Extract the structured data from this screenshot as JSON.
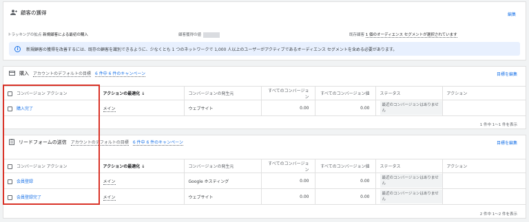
{
  "header": {
    "title": "顧客の獲得",
    "edit": "編集",
    "tracking_label": "トラッキングの拡点",
    "tracking_value": "新規顧客による最初の購入",
    "value_label": "顧客獲得の値",
    "existing_label": "既存顧客",
    "existing_value": "1 個のオーディエンス セグメントが選択されています",
    "info": "新規顧客の獲得を改善するには、既存の顧客を識別できるように、少なくとも 1 つのネットワークで 1,000 人以上のユーザーがアクティブであるオーディエンス セグメントを含める必要があります。"
  },
  "columns": [
    "コンバージョン アクション",
    "アクションの最適化",
    "コンバージョンの発生元",
    "すべてのコンバージョン",
    "すべてのコンバージョン値",
    "ステータス",
    "アクション"
  ],
  "sort_icon": "arrow-down-icon",
  "sections": [
    {
      "title": "購入",
      "goal": "アカウントのデフォルトの目標",
      "campaigns": "6 件中 6 件のキャンペーン",
      "edit": "目標を編集",
      "rows": [
        {
          "action": "購入完了",
          "opt": "メイン",
          "source": "ウェブサイト",
          "conv": "0.00",
          "value": "0.00",
          "status": "最近のコンバージョンはありません"
        }
      ],
      "footer": "1 件中 1〜1 件を表示"
    },
    {
      "title": "リードフォームの送信",
      "goal": "アカウントのデフォルトの目標",
      "campaigns": "6 件中 6 件のキャンペーン",
      "edit": "目標を編集",
      "rows": [
        {
          "action": "会員登録",
          "opt": "メイン",
          "source": "Google ホスティング",
          "conv": "0.00",
          "value": "0.00",
          "status": "最近のコンバージョンはありません"
        },
        {
          "action": "会員登録完了",
          "opt": "メイン",
          "source": "ウェブサイト",
          "conv": "0.00",
          "value": "0.00",
          "status": "最近のコンバージョンはありません"
        }
      ],
      "footer": "2 件中 1〜2 件を表示"
    }
  ],
  "colors": {
    "accent": "#1a73e8",
    "highlight": "#d93025"
  }
}
